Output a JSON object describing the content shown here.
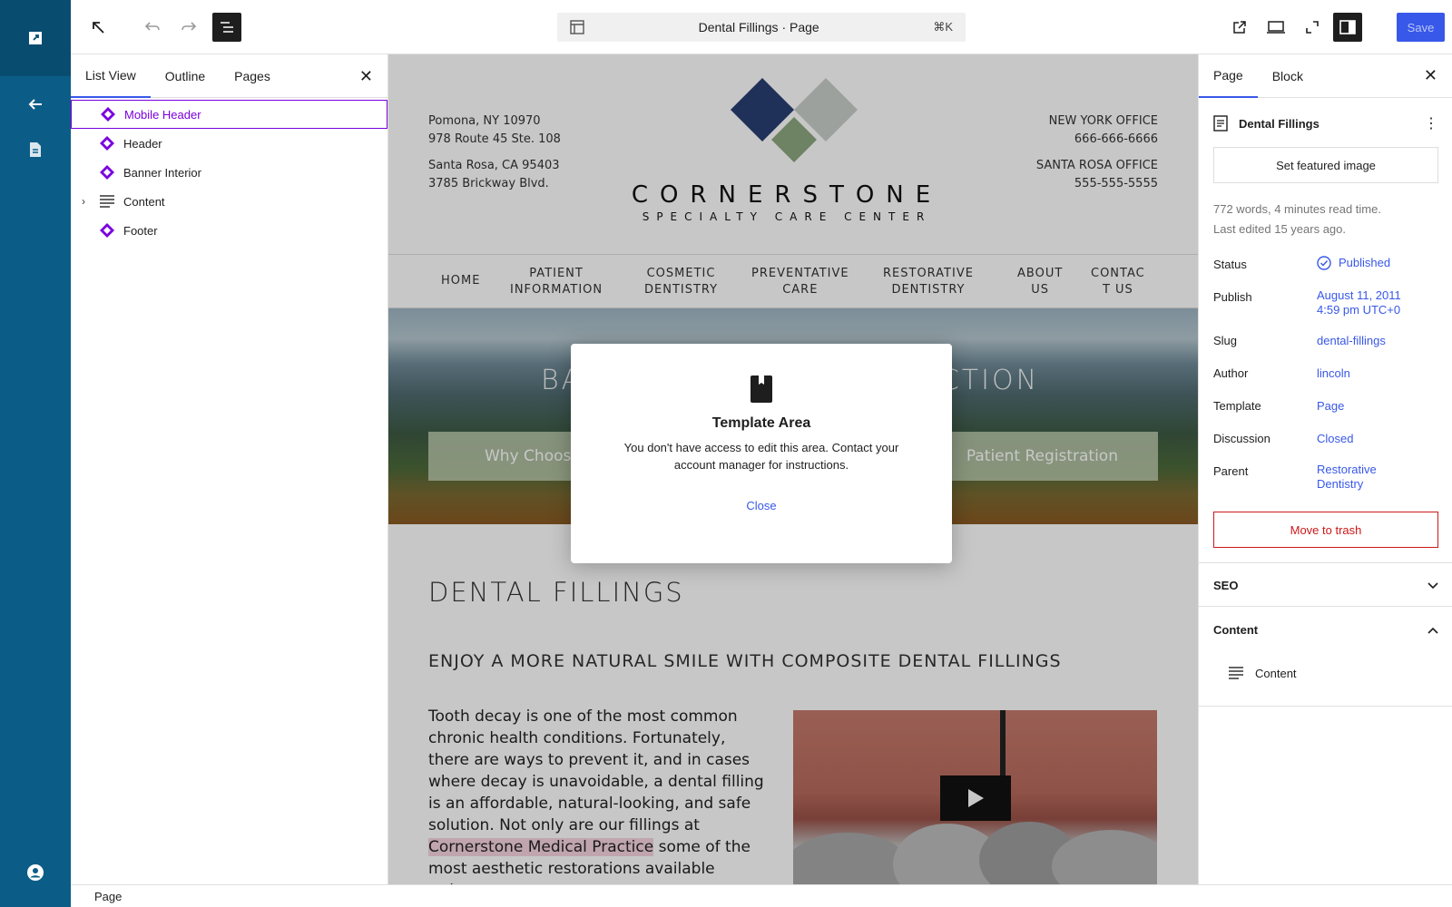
{
  "toolbar": {
    "document_title": "Dental Fillings · Page",
    "shortcut": "⌘K",
    "save_label": "Save"
  },
  "list_view": {
    "tabs": [
      "List View",
      "Outline",
      "Pages"
    ],
    "items": [
      {
        "label": "Mobile Header",
        "icon": "template-part-icon",
        "selected": true
      },
      {
        "label": "Header",
        "icon": "template-part-icon"
      },
      {
        "label": "Banner Interior",
        "icon": "template-part-icon"
      },
      {
        "label": "Content",
        "icon": "post-content-icon",
        "expandable": true
      },
      {
        "label": "Footer",
        "icon": "template-part-icon"
      }
    ]
  },
  "status_footer": "Page",
  "site": {
    "address_1_line1": "Pomona, NY 10970",
    "address_1_line2": "978 Route 45 Ste. 108",
    "address_2_line1": "Santa Rosa, CA 95403",
    "address_2_line2": "3785 Brickway Blvd.",
    "office_1_name": "NEW YORK OFFICE",
    "office_1_phone": "666-666-6666",
    "office_2_name": "SANTA ROSA OFFICE",
    "office_2_phone": "555-555-5555",
    "logo_line1": "CORNERSTONE",
    "logo_line2": "SPECIALTY CARE CENTER",
    "nav": [
      {
        "l1": "HOME",
        "l2": ""
      },
      {
        "l1": "PATIENT",
        "l2": "INFORMATION"
      },
      {
        "l1": "COSMETIC",
        "l2": "DENTISTRY"
      },
      {
        "l1": "PREVENTATIVE",
        "l2": "CARE"
      },
      {
        "l1": "RESTORATIVE",
        "l2": "DENTISTRY"
      },
      {
        "l1": "ABOUT",
        "l2": "US"
      },
      {
        "l1": "CONTAC",
        "l2": "T US"
      }
    ],
    "banner_title_left": "BA",
    "banner_title_right": "ICTION",
    "banner_btn_left": "Why Choos",
    "banner_btn_right": "Patient Registration",
    "page_heading": "DENTAL FILLINGS",
    "subheading": "ENJOY A MORE NATURAL SMILE WITH COMPOSITE DENTAL FILLINGS",
    "body_part1": "Tooth decay is one of the most common chronic health conditions. Fortunately, there are ways to prevent it, and in cases where decay is unavoidable, a dental filling is an affordable, natural-looking, and safe solution. Not only are our fillings at ",
    "body_highlight": "Cornerstone Medical Practice",
    "body_part2": " some of the most aesthetic restorations available today,"
  },
  "modal": {
    "title": "Template Area",
    "description": "You don't have access to edit this area. Contact your account manager for instructions.",
    "close_label": "Close"
  },
  "settings": {
    "tabs": [
      "Page",
      "Block"
    ],
    "doc_title": "Dental Fillings",
    "featured_image_label": "Set featured image",
    "stats_line1": "772 words, 4 minutes read time.",
    "stats_line2": "Last edited 15 years ago.",
    "status_label": "Status",
    "status_value": "Published",
    "publish_label": "Publish",
    "publish_value_line1": "August 11, 2011",
    "publish_value_line2": "4:59 pm UTC+0",
    "slug_label": "Slug",
    "slug_value": "dental-fillings",
    "author_label": "Author",
    "author_value": "lincoln",
    "template_label": "Template",
    "template_value": "Page",
    "discussion_label": "Discussion",
    "discussion_value": "Closed",
    "parent_label": "Parent",
    "parent_value_line1": "Restorative",
    "parent_value_line2": "Dentistry",
    "trash_label": "Move to trash",
    "seo_label": "SEO",
    "content_panel_label": "Content",
    "content_item_label": "Content"
  },
  "colors": {
    "rail": "#0b5d87",
    "accent": "#3858e9",
    "selection": "#7a00df",
    "danger": "#cc1818"
  }
}
